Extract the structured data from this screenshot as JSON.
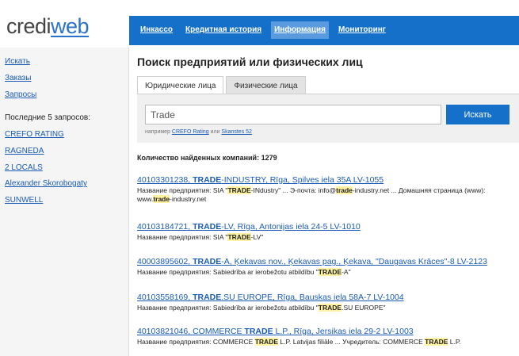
{
  "logo": {
    "part1": "credi",
    "part2": "web"
  },
  "nav": [
    {
      "label": "Инкассо"
    },
    {
      "label": "Кредитная история"
    },
    {
      "label": "Информация"
    },
    {
      "label": "Мониторинг"
    }
  ],
  "sidebar": {
    "links": [
      "Искать",
      "Заказы",
      "Запросы"
    ],
    "recent_title": "Последние 5 запросов:",
    "recent": [
      "CREFO RATING",
      "RAGNEDA",
      "2 LOCALS",
      "Alexander Skorobogaty",
      "SUNWELL"
    ]
  },
  "main": {
    "title": "Поиск предприятий или физических лиц",
    "tabs": [
      "Юридические лица",
      "Физические лица"
    ],
    "search": {
      "value": "Trade",
      "button": "Искать"
    },
    "hint": {
      "prefix": "например",
      "ex1": "CREFO Rating",
      "or": "или",
      "ex2": "Skanstes 52"
    },
    "count": "Количество найденных компаний: 1279"
  },
  "results": [
    {
      "title": [
        "40103301238, ",
        "TRADE",
        "-INDUSTRY, Rīga, Spilves iela 35A LV-1055"
      ],
      "desc": [
        "Название предприятия: SIA \"",
        "TRADE",
        "-INdustry\" ... Э-почта: info@",
        "trade",
        "-industry.net ... Домашняя страница (www): www.",
        "trade",
        "-industry.net"
      ]
    },
    {
      "title": [
        "40103184721, ",
        "TRADE",
        "-LV, Rīga, Antonijas iela 24-5 LV-1010"
      ],
      "desc": [
        "Название предприятия: SIA \"",
        "TRADE",
        "-LV\""
      ]
    },
    {
      "title": [
        "40003895602, ",
        "TRADE",
        "-A, Ķekavas nov., Ķekavas pag., Ķekava, \"Daugavas Krāces\"-8 LV-2123"
      ],
      "desc": [
        "Название предприятия: Sabiedrība ar ierobežotu atbildību \"",
        "TRADE",
        "-A\""
      ]
    },
    {
      "title": [
        "40103558169, ",
        "TRADE",
        ".SU EUROPE, Rīga, Bauskas iela 58A-7 LV-1004"
      ],
      "desc": [
        "Название предприятия: Sabiedrība ar ierobežotu atbildību \"",
        "TRADE",
        ".SU EUROPE\""
      ]
    },
    {
      "title": [
        "40103821046, COMMERCE ",
        "TRADE",
        " L.P., Rīga, Jersikas iela 29-2 LV-1003"
      ],
      "desc": [
        "Название предприятия: COMMERCE ",
        "TRADE",
        " L.P. Latvijas filiāle ... Учредитель: COMMERCE ",
        "TRADE",
        " L.P."
      ]
    }
  ]
}
